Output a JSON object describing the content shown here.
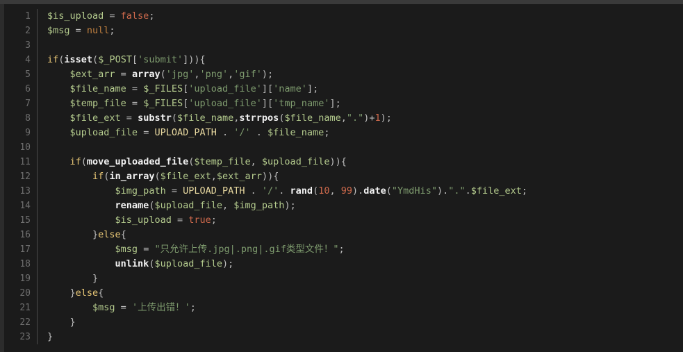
{
  "editor": {
    "language": "php",
    "theme": "dark",
    "background_color": "#1b1b1b",
    "gutter_color": "#6f6f6f",
    "first_line_number": 1,
    "last_line_number": 23,
    "total_lines": 23,
    "colors": {
      "variable": "#b5cc8e",
      "keyword": "#e8c776",
      "function": "#f2f2f2",
      "string": "#7e9b6e",
      "number": "#cf6a4c",
      "constant": "#e8d9a0",
      "boolean": "#cf6a4c",
      "null": "#c08040",
      "punctuation": "#bdbdbd"
    }
  },
  "code": {
    "lines": [
      {
        "number": "1",
        "text": "$is_upload = false;",
        "tokens": [
          {
            "t": "$is_upload",
            "c": "t-var"
          },
          {
            "t": " = ",
            "c": "t-operator"
          },
          {
            "t": "false",
            "c": "t-bool"
          },
          {
            "t": ";",
            "c": "t-punct"
          }
        ]
      },
      {
        "number": "2",
        "text": "$msg = null;",
        "tokens": [
          {
            "t": "$msg",
            "c": "t-var"
          },
          {
            "t": " = ",
            "c": "t-operator"
          },
          {
            "t": "null",
            "c": "t-null"
          },
          {
            "t": ";",
            "c": "t-punct"
          }
        ]
      },
      {
        "number": "3",
        "text": "",
        "tokens": []
      },
      {
        "number": "4",
        "text": "if(isset($_POST['submit'])){",
        "tokens": [
          {
            "t": "if",
            "c": "t-keyword"
          },
          {
            "t": "(",
            "c": "t-punct"
          },
          {
            "t": "isset",
            "c": "t-function"
          },
          {
            "t": "(",
            "c": "t-punct"
          },
          {
            "t": "$_POST",
            "c": "t-var"
          },
          {
            "t": "[",
            "c": "t-punct"
          },
          {
            "t": "'submit'",
            "c": "t-string"
          },
          {
            "t": "])){",
            "c": "t-punct"
          }
        ]
      },
      {
        "number": "5",
        "text": "    $ext_arr = array('jpg','png','gif');",
        "tokens": [
          {
            "t": "    ",
            "c": "t-plain"
          },
          {
            "t": "$ext_arr",
            "c": "t-var"
          },
          {
            "t": " = ",
            "c": "t-operator"
          },
          {
            "t": "array",
            "c": "t-function"
          },
          {
            "t": "(",
            "c": "t-punct"
          },
          {
            "t": "'jpg'",
            "c": "t-string"
          },
          {
            "t": ",",
            "c": "t-punct"
          },
          {
            "t": "'png'",
            "c": "t-string"
          },
          {
            "t": ",",
            "c": "t-punct"
          },
          {
            "t": "'gif'",
            "c": "t-string"
          },
          {
            "t": ");",
            "c": "t-punct"
          }
        ]
      },
      {
        "number": "6",
        "text": "    $file_name = $_FILES['upload_file']['name'];",
        "tokens": [
          {
            "t": "    ",
            "c": "t-plain"
          },
          {
            "t": "$file_name",
            "c": "t-var"
          },
          {
            "t": " = ",
            "c": "t-operator"
          },
          {
            "t": "$_FILES",
            "c": "t-var"
          },
          {
            "t": "[",
            "c": "t-punct"
          },
          {
            "t": "'upload_file'",
            "c": "t-string"
          },
          {
            "t": "][",
            "c": "t-punct"
          },
          {
            "t": "'name'",
            "c": "t-string"
          },
          {
            "t": "];",
            "c": "t-punct"
          }
        ]
      },
      {
        "number": "7",
        "text": "    $temp_file = $_FILES['upload_file']['tmp_name'];",
        "tokens": [
          {
            "t": "    ",
            "c": "t-plain"
          },
          {
            "t": "$temp_file",
            "c": "t-var"
          },
          {
            "t": " = ",
            "c": "t-operator"
          },
          {
            "t": "$_FILES",
            "c": "t-var"
          },
          {
            "t": "[",
            "c": "t-punct"
          },
          {
            "t": "'upload_file'",
            "c": "t-string"
          },
          {
            "t": "][",
            "c": "t-punct"
          },
          {
            "t": "'tmp_name'",
            "c": "t-string"
          },
          {
            "t": "];",
            "c": "t-punct"
          }
        ]
      },
      {
        "number": "8",
        "text": "    $file_ext = substr($file_name,strrpos($file_name,\".\")+1);",
        "tokens": [
          {
            "t": "    ",
            "c": "t-plain"
          },
          {
            "t": "$file_ext",
            "c": "t-var"
          },
          {
            "t": " = ",
            "c": "t-operator"
          },
          {
            "t": "substr",
            "c": "t-function"
          },
          {
            "t": "(",
            "c": "t-punct"
          },
          {
            "t": "$file_name",
            "c": "t-var"
          },
          {
            "t": ",",
            "c": "t-punct"
          },
          {
            "t": "strrpos",
            "c": "t-function"
          },
          {
            "t": "(",
            "c": "t-punct"
          },
          {
            "t": "$file_name",
            "c": "t-var"
          },
          {
            "t": ",",
            "c": "t-punct"
          },
          {
            "t": "\".\"",
            "c": "t-string"
          },
          {
            "t": ")+",
            "c": "t-punct"
          },
          {
            "t": "1",
            "c": "t-number"
          },
          {
            "t": ");",
            "c": "t-punct"
          }
        ]
      },
      {
        "number": "9",
        "text": "    $upload_file = UPLOAD_PATH . '/' . $file_name;",
        "tokens": [
          {
            "t": "    ",
            "c": "t-plain"
          },
          {
            "t": "$upload_file",
            "c": "t-var"
          },
          {
            "t": " = ",
            "c": "t-operator"
          },
          {
            "t": "UPLOAD_PATH",
            "c": "t-constant"
          },
          {
            "t": " . ",
            "c": "t-punct"
          },
          {
            "t": "'/'",
            "c": "t-string"
          },
          {
            "t": " . ",
            "c": "t-punct"
          },
          {
            "t": "$file_name",
            "c": "t-var"
          },
          {
            "t": ";",
            "c": "t-punct"
          }
        ]
      },
      {
        "number": "10",
        "text": "",
        "tokens": []
      },
      {
        "number": "11",
        "text": "    if(move_uploaded_file($temp_file, $upload_file)){",
        "tokens": [
          {
            "t": "    ",
            "c": "t-plain"
          },
          {
            "t": "if",
            "c": "t-keyword"
          },
          {
            "t": "(",
            "c": "t-punct"
          },
          {
            "t": "move_uploaded_file",
            "c": "t-function"
          },
          {
            "t": "(",
            "c": "t-punct"
          },
          {
            "t": "$temp_file",
            "c": "t-var"
          },
          {
            "t": ", ",
            "c": "t-punct"
          },
          {
            "t": "$upload_file",
            "c": "t-var"
          },
          {
            "t": ")){",
            "c": "t-punct"
          }
        ]
      },
      {
        "number": "12",
        "text": "        if(in_array($file_ext,$ext_arr)){",
        "tokens": [
          {
            "t": "        ",
            "c": "t-plain"
          },
          {
            "t": "if",
            "c": "t-keyword"
          },
          {
            "t": "(",
            "c": "t-punct"
          },
          {
            "t": "in_array",
            "c": "t-function"
          },
          {
            "t": "(",
            "c": "t-punct"
          },
          {
            "t": "$file_ext",
            "c": "t-var"
          },
          {
            "t": ",",
            "c": "t-punct"
          },
          {
            "t": "$ext_arr",
            "c": "t-var"
          },
          {
            "t": ")){",
            "c": "t-punct"
          }
        ]
      },
      {
        "number": "13",
        "text": "            $img_path = UPLOAD_PATH . '/'. rand(10, 99).date(\"YmdHis\").\".\".$file_ext;",
        "tokens": [
          {
            "t": "            ",
            "c": "t-plain"
          },
          {
            "t": "$img_path",
            "c": "t-var"
          },
          {
            "t": " = ",
            "c": "t-operator"
          },
          {
            "t": "UPLOAD_PATH",
            "c": "t-constant"
          },
          {
            "t": " . ",
            "c": "t-punct"
          },
          {
            "t": "'/'",
            "c": "t-string"
          },
          {
            "t": ". ",
            "c": "t-punct"
          },
          {
            "t": "rand",
            "c": "t-function"
          },
          {
            "t": "(",
            "c": "t-punct"
          },
          {
            "t": "10",
            "c": "t-number"
          },
          {
            "t": ", ",
            "c": "t-punct"
          },
          {
            "t": "99",
            "c": "t-number"
          },
          {
            "t": ").",
            "c": "t-punct"
          },
          {
            "t": "date",
            "c": "t-function"
          },
          {
            "t": "(",
            "c": "t-punct"
          },
          {
            "t": "\"YmdHis\"",
            "c": "t-string"
          },
          {
            "t": ").",
            "c": "t-punct"
          },
          {
            "t": "\".\"",
            "c": "t-string"
          },
          {
            "t": ".",
            "c": "t-punct"
          },
          {
            "t": "$file_ext",
            "c": "t-var"
          },
          {
            "t": ";",
            "c": "t-punct"
          }
        ]
      },
      {
        "number": "14",
        "text": "            rename($upload_file, $img_path);",
        "tokens": [
          {
            "t": "            ",
            "c": "t-plain"
          },
          {
            "t": "rename",
            "c": "t-function"
          },
          {
            "t": "(",
            "c": "t-punct"
          },
          {
            "t": "$upload_file",
            "c": "t-var"
          },
          {
            "t": ", ",
            "c": "t-punct"
          },
          {
            "t": "$img_path",
            "c": "t-var"
          },
          {
            "t": ");",
            "c": "t-punct"
          }
        ]
      },
      {
        "number": "15",
        "text": "            $is_upload = true;",
        "tokens": [
          {
            "t": "            ",
            "c": "t-plain"
          },
          {
            "t": "$is_upload",
            "c": "t-var"
          },
          {
            "t": " = ",
            "c": "t-operator"
          },
          {
            "t": "true",
            "c": "t-bool"
          },
          {
            "t": ";",
            "c": "t-punct"
          }
        ]
      },
      {
        "number": "16",
        "text": "        }else{",
        "tokens": [
          {
            "t": "        ",
            "c": "t-plain"
          },
          {
            "t": "}",
            "c": "t-punct"
          },
          {
            "t": "else",
            "c": "t-keyword"
          },
          {
            "t": "{",
            "c": "t-punct"
          }
        ]
      },
      {
        "number": "17",
        "text": "            $msg = \"只允许上传.jpg|.png|.gif类型文件！\";",
        "tokens": [
          {
            "t": "            ",
            "c": "t-plain"
          },
          {
            "t": "$msg",
            "c": "t-var"
          },
          {
            "t": " = ",
            "c": "t-operator"
          },
          {
            "t": "\"只允许上传.jpg|.png|.gif类型文件！\"",
            "c": "t-string"
          },
          {
            "t": ";",
            "c": "t-punct"
          }
        ]
      },
      {
        "number": "18",
        "text": "            unlink($upload_file);",
        "tokens": [
          {
            "t": "            ",
            "c": "t-plain"
          },
          {
            "t": "unlink",
            "c": "t-function"
          },
          {
            "t": "(",
            "c": "t-punct"
          },
          {
            "t": "$upload_file",
            "c": "t-var"
          },
          {
            "t": ");",
            "c": "t-punct"
          }
        ]
      },
      {
        "number": "19",
        "text": "        }",
        "tokens": [
          {
            "t": "        ",
            "c": "t-plain"
          },
          {
            "t": "}",
            "c": "t-punct"
          }
        ]
      },
      {
        "number": "20",
        "text": "    }else{",
        "tokens": [
          {
            "t": "    ",
            "c": "t-plain"
          },
          {
            "t": "}",
            "c": "t-punct"
          },
          {
            "t": "else",
            "c": "t-keyword"
          },
          {
            "t": "{",
            "c": "t-punct"
          }
        ]
      },
      {
        "number": "21",
        "text": "        $msg = '上传出错！';",
        "tokens": [
          {
            "t": "        ",
            "c": "t-plain"
          },
          {
            "t": "$msg",
            "c": "t-var"
          },
          {
            "t": " = ",
            "c": "t-operator"
          },
          {
            "t": "'上传出错！'",
            "c": "t-string"
          },
          {
            "t": ";",
            "c": "t-punct"
          }
        ]
      },
      {
        "number": "22",
        "text": "    }",
        "tokens": [
          {
            "t": "    ",
            "c": "t-plain"
          },
          {
            "t": "}",
            "c": "t-punct"
          }
        ]
      },
      {
        "number": "23",
        "text": "}",
        "tokens": [
          {
            "t": "}",
            "c": "t-punct"
          }
        ]
      }
    ]
  }
}
